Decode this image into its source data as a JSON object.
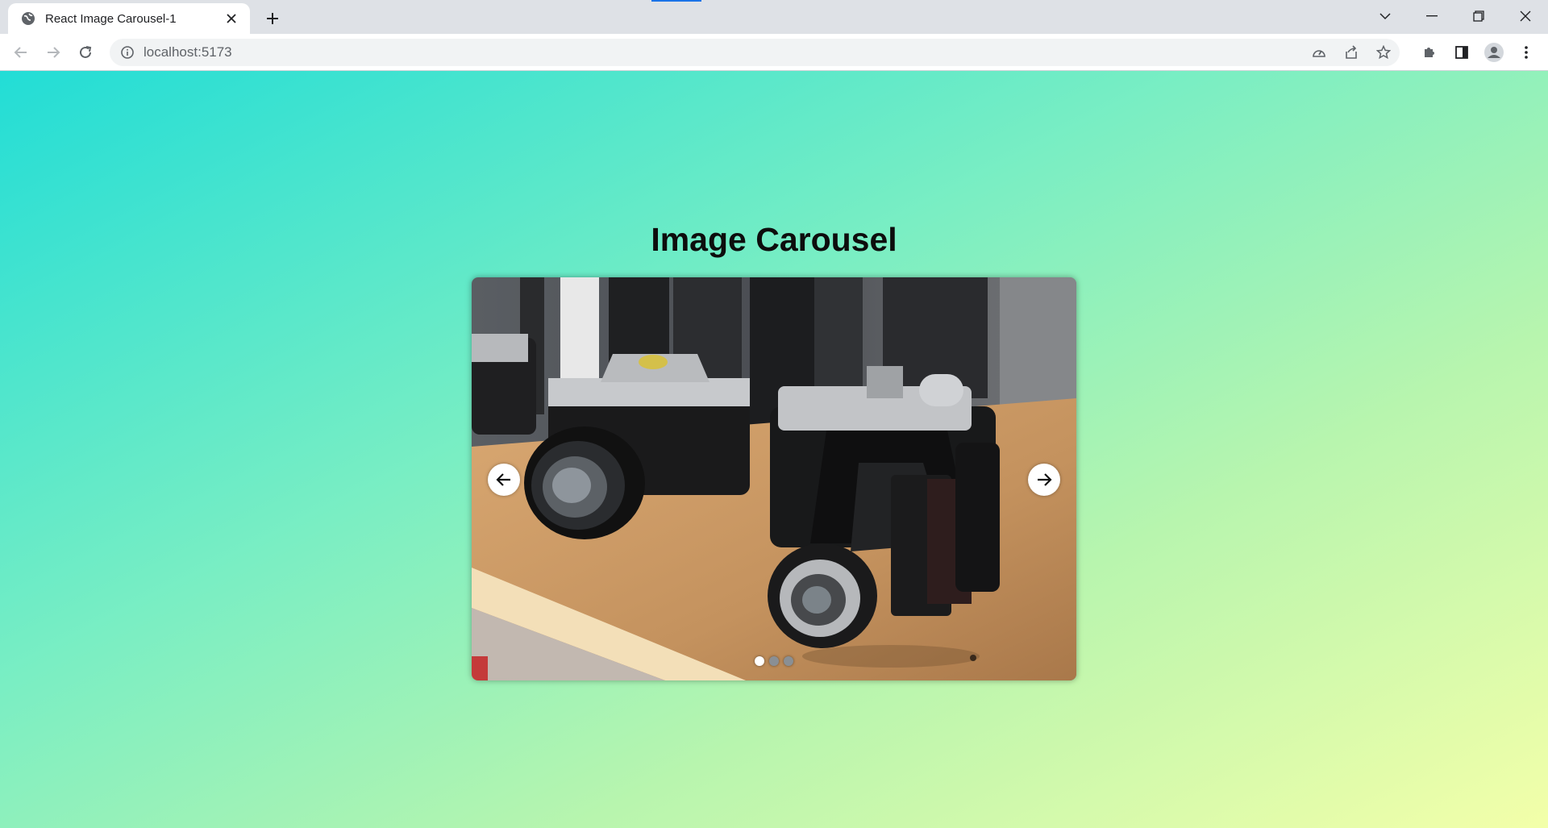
{
  "browser": {
    "tab": {
      "title": "React Image Carousel-1",
      "favicon": "globe-icon"
    },
    "omnibox": {
      "url": "localhost:5173"
    },
    "icons": {
      "back": "arrow-left-icon",
      "forward": "arrow-right-icon",
      "reload": "reload-icon",
      "site_info": "info-icon",
      "performance": "speedometer-icon",
      "share": "share-icon",
      "bookmark": "star-icon",
      "extensions": "puzzle-icon",
      "side_panel": "side-panel-icon",
      "profile": "profile-icon",
      "menu": "kebab-menu-icon"
    }
  },
  "page": {
    "heading": "Image Carousel",
    "carousel": {
      "current_slide": 1,
      "slide_count": 3,
      "image_subject": "vintage cameras on wooden shelf",
      "prev_icon": "arrow-left-icon",
      "next_icon": "arrow-right-icon"
    }
  },
  "colors": {
    "gradient_start": "#22ddd6",
    "gradient_end": "#f3ffa9",
    "heading": "#0d0d0d",
    "button_bg": "#ffffff",
    "dot_active": "#ffffff",
    "dot_inactive": "#8a8f94"
  }
}
